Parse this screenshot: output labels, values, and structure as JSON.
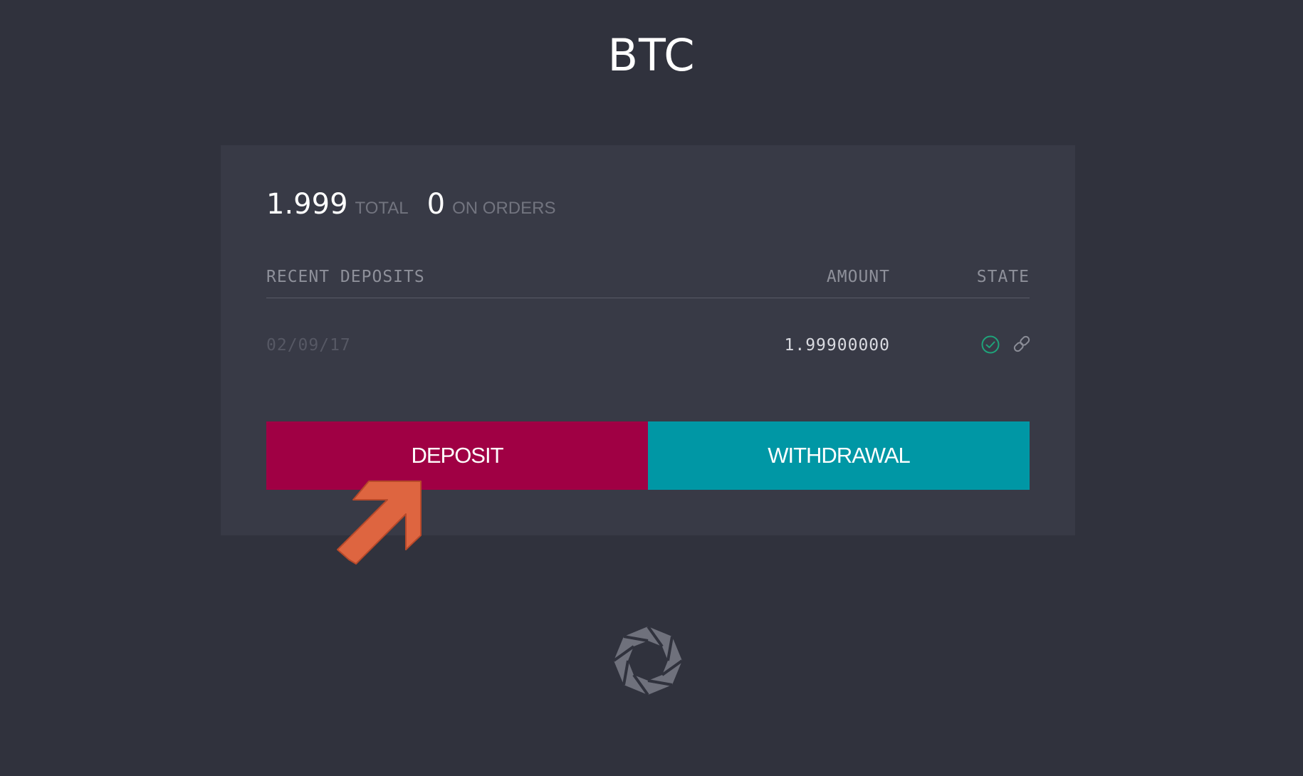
{
  "page": {
    "title": "BTC"
  },
  "balances": {
    "total_value": "1.999",
    "total_label": "TOTAL",
    "orders_value": "0",
    "orders_label": "ON ORDERS"
  },
  "deposits_table": {
    "headers": {
      "recent": "RECENT DEPOSITS",
      "amount": "AMOUNT",
      "state": "STATE"
    },
    "rows": [
      {
        "date": "02/09/17",
        "amount": "1.99900000",
        "state_icon": "check-circle-icon",
        "link_icon": "chain-link-icon"
      }
    ]
  },
  "actions": {
    "deposit_label": "DEPOSIT",
    "withdrawal_label": "WITHDRAWAL"
  },
  "colors": {
    "background": "#30323d",
    "card": "#383a46",
    "deposit": "#a00044",
    "withdrawal": "#0097a5",
    "success": "#1fa37a",
    "annotation_arrow": "#de6540",
    "logo": "#6f717c"
  },
  "annotation": {
    "icon": "arrow-up-right-icon"
  },
  "footer": {
    "logo_icon": "octagon-logo-icon"
  }
}
